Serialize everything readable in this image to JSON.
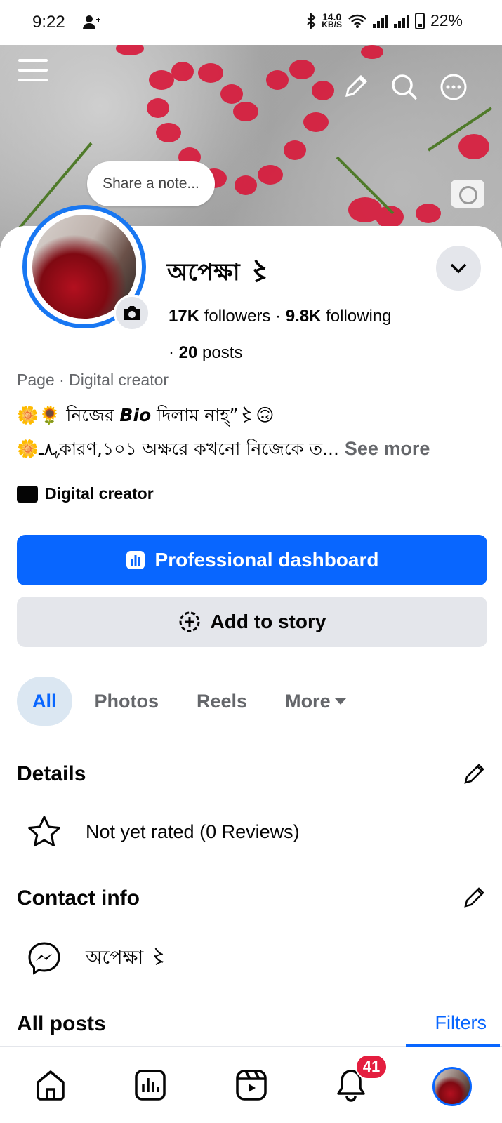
{
  "status_bar": {
    "time": "9:22",
    "net_speed": "14.0",
    "net_unit": "KB/S",
    "battery": "22%"
  },
  "cover": {
    "note_placeholder": "Share a note..."
  },
  "profile": {
    "name": "অপেক্ষা 〻",
    "followers_count": "17K",
    "followers_label": "followers",
    "following_count": "9.8K",
    "following_label": "following",
    "posts_count": "20",
    "posts_label": "posts",
    "category_line": "Page · Digital creator",
    "bio_line1": "🌼🌻 নিজের ",
    "bio_bold": "Bio",
    "bio_line1_end": " দিলাম নাহ্”〻🙃",
    "bio_line2": "🌼ﮩ٨ـকারণ,১০১ অক্ষরে কখনো নিজেকে ত... ",
    "see_more": "See more",
    "creator_label": "Digital creator"
  },
  "buttons": {
    "dashboard": "Professional dashboard",
    "add_story": "Add to story"
  },
  "tabs": {
    "all": "All",
    "photos": "Photos",
    "reels": "Reels",
    "more": "More"
  },
  "details": {
    "title": "Details",
    "rating": "Not yet rated (0 Reviews)"
  },
  "contact": {
    "title": "Contact info",
    "messenger_name": "অপেক্ষা 〻"
  },
  "posts": {
    "title": "All posts",
    "filters": "Filters"
  },
  "bottom_nav": {
    "notifications_badge": "41"
  },
  "colors": {
    "accent": "#0866ff",
    "badge": "#e41e3f",
    "secondary_bg": "#e4e6eb"
  }
}
